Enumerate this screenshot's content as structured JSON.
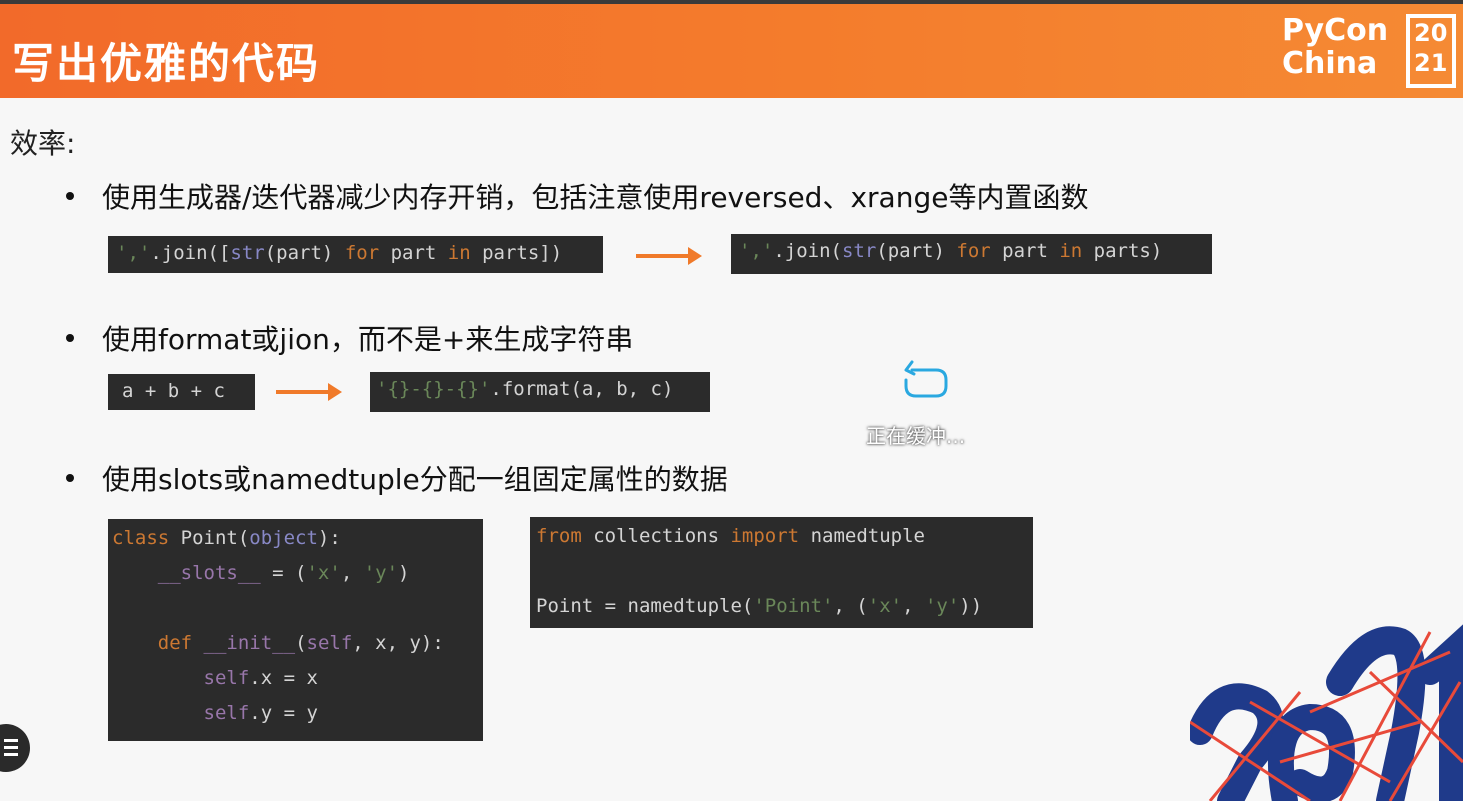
{
  "slide": {
    "title": "写出优雅的代码",
    "logo": {
      "line1": "PyCon",
      "line2": "China",
      "year_top": "20",
      "year_bottom": "21"
    },
    "subhead": "效率:",
    "bullets": [
      "使用生成器/迭代器减少内存开销，包括注意使用reversed、xrange等内置函数",
      "使用format或jion，而不是+来生成字符串",
      "使用slots或namedtuple分配一组固定属性的数据"
    ]
  },
  "code": {
    "join_before": "','.join([str(part) for part in parts])",
    "join_after": "','.join(str(part) for part in parts)",
    "concat_before": "a + b + c",
    "format_after": "'{}-{}-{}'.format(a, b, c)",
    "slots_class": [
      "class Point(object):",
      "    __slots__ = ('x', 'y')",
      "",
      "    def __init__(self, x, y):",
      "        self.x = x",
      "        self.y = y"
    ],
    "namedtuple": [
      "from collections import namedtuple",
      "",
      "Point = namedtuple('Point', ('x', 'y'))"
    ]
  },
  "player": {
    "buffering_text": "正在缓冲...",
    "icon": "refresh-icon",
    "menu_icon": "menu-icon"
  },
  "colors": {
    "header": "#f26a2a",
    "arrow": "#f07a2a",
    "code_bg": "#2b2b2b",
    "keyword": "#cc7832",
    "string": "#6a8759"
  }
}
